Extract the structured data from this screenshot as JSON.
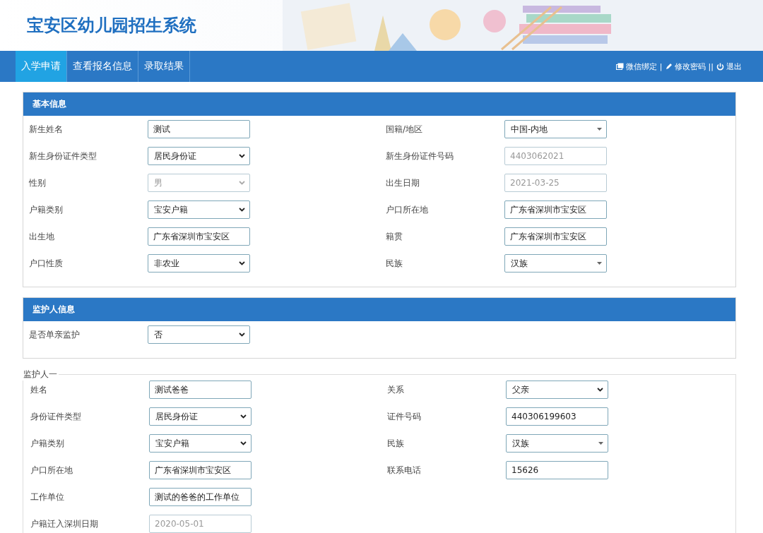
{
  "header": {
    "title": "宝安区幼儿园招生系统"
  },
  "nav": {
    "tabs": [
      {
        "label": "入学申请",
        "selected": true
      },
      {
        "label": "查看报名信息",
        "selected": false
      },
      {
        "label": "录取结果",
        "selected": false
      }
    ],
    "links": [
      {
        "kind": "bind",
        "label": "微信绑定"
      },
      {
        "kind": "separator",
        "label": "|"
      },
      {
        "kind": "password",
        "label": "修改密码"
      },
      {
        "kind": "separator",
        "label": "||"
      },
      {
        "kind": "logout",
        "label": "退出"
      }
    ]
  },
  "basic_info": {
    "title": "基本信息",
    "rows": [
      [
        {
          "label": "新生姓名",
          "kind": "text",
          "value": "测试",
          "disabled": false
        },
        {
          "label": "国籍/地区",
          "kind": "combo",
          "value": "中国-内地",
          "disabled": false
        }
      ],
      [
        {
          "label": "新生身份证件类型",
          "kind": "select",
          "value": "居民身份证",
          "disabled": false
        },
        {
          "label": "新生身份证件号码",
          "kind": "text",
          "value": "4403062021",
          "disabled": true
        }
      ],
      [
        {
          "label": "性别",
          "kind": "select",
          "value": "男",
          "disabled": true
        },
        {
          "label": "出生日期",
          "kind": "text",
          "value": "2021-03-25",
          "disabled": true
        }
      ],
      [
        {
          "label": "户籍类别",
          "kind": "select",
          "value": "宝安户籍",
          "disabled": false
        },
        {
          "label": "户口所在地",
          "kind": "text",
          "value": "广东省深圳市宝安区",
          "disabled": false
        }
      ],
      [
        {
          "label": "出生地",
          "kind": "text",
          "value": "广东省深圳市宝安区",
          "disabled": false
        },
        {
          "label": "籍贯",
          "kind": "text",
          "value": "广东省深圳市宝安区",
          "disabled": false
        }
      ],
      [
        {
          "label": "户口性质",
          "kind": "select",
          "value": "非农业",
          "disabled": false
        },
        {
          "label": "民族",
          "kind": "combo",
          "value": "汉族",
          "disabled": false
        }
      ]
    ]
  },
  "guardian_info": {
    "title": "监护人信息",
    "rows": [
      [
        {
          "label": "是否单亲监护",
          "kind": "select",
          "value": "否",
          "disabled": false
        }
      ]
    ]
  },
  "guardian_one": {
    "legend": "监护人一",
    "rows": [
      [
        {
          "label": "姓名",
          "kind": "text",
          "value": "测试爸爸",
          "disabled": false
        },
        {
          "label": "关系",
          "kind": "select",
          "value": "父亲",
          "disabled": false
        }
      ],
      [
        {
          "label": "身份证件类型",
          "kind": "select",
          "value": "居民身份证",
          "disabled": false
        },
        {
          "label": "证件号码",
          "kind": "text",
          "value": "440306199603",
          "disabled": false
        }
      ],
      [
        {
          "label": "户籍类别",
          "kind": "select",
          "value": "宝安户籍",
          "disabled": false
        },
        {
          "label": "民族",
          "kind": "combo",
          "value": "汉族",
          "disabled": false
        }
      ],
      [
        {
          "label": "户口所在地",
          "kind": "text",
          "value": "广东省深圳市宝安区",
          "disabled": false
        },
        {
          "label": "联系电话",
          "kind": "text",
          "value": "15626",
          "disabled": false
        }
      ],
      [
        {
          "label": "工作单位",
          "kind": "text",
          "value": "测试的爸爸的工作单位",
          "disabled": false
        }
      ],
      [
        {
          "label": "户籍迁入深圳日期",
          "kind": "text",
          "value": "2020-05-01",
          "disabled": true
        }
      ]
    ]
  }
}
